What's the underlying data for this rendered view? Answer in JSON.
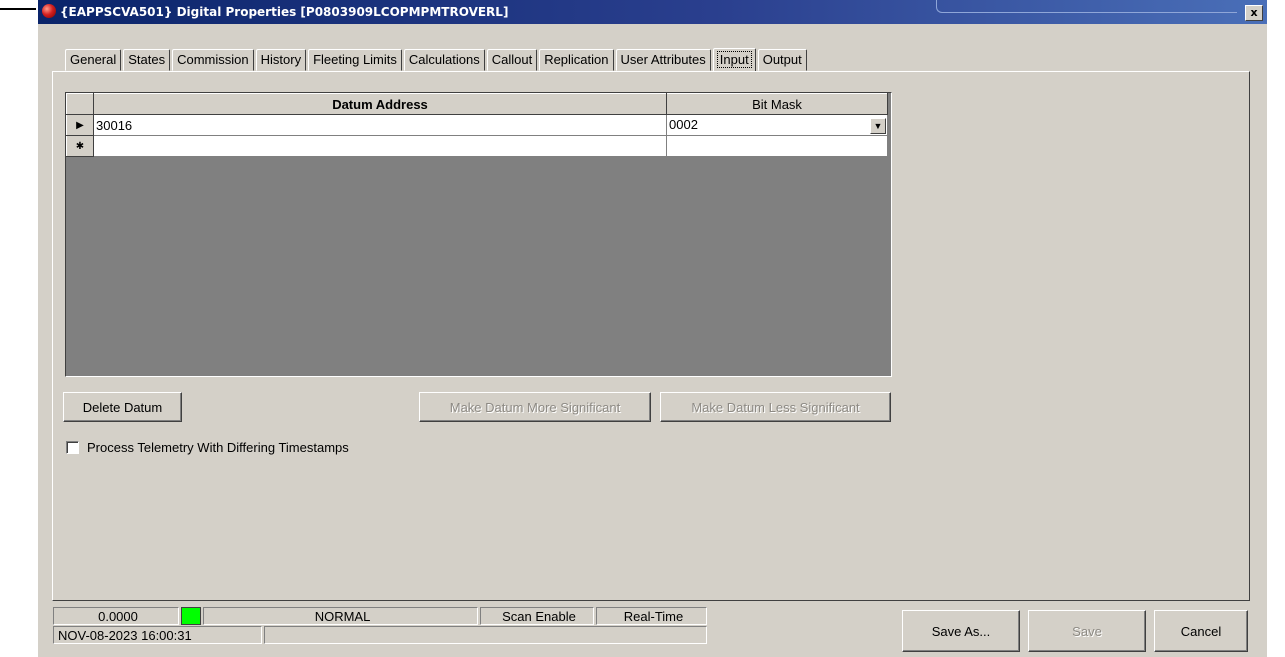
{
  "window": {
    "title": "{EAPPSCVA501} Digital Properties [P0803909LCOPMPMTROVERL]",
    "close_label": "x"
  },
  "tabs": [
    {
      "label": "General"
    },
    {
      "label": "States"
    },
    {
      "label": "Commission"
    },
    {
      "label": "History"
    },
    {
      "label": "Fleeting Limits"
    },
    {
      "label": "Calculations"
    },
    {
      "label": "Callout"
    },
    {
      "label": "Replication"
    },
    {
      "label": "User Attributes"
    },
    {
      "label": "Input",
      "active": true
    },
    {
      "label": "Output"
    }
  ],
  "grid": {
    "headers": {
      "datum_address": "Datum Address",
      "bit_mask": "Bit Mask"
    },
    "rows": [
      {
        "indicator": "▶",
        "datum_address": "30016",
        "bit_mask": "0002"
      },
      {
        "indicator": "✱",
        "datum_address": "",
        "bit_mask": ""
      }
    ]
  },
  "buttons": {
    "delete_datum": "Delete Datum",
    "more_significant": "Make Datum More Significant",
    "less_significant": "Make Datum Less Significant",
    "save_as": "Save As...",
    "save": "Save",
    "cancel": "Cancel"
  },
  "checkbox": {
    "label": "Process Telemetry With Differing Timestamps",
    "checked": false
  },
  "status": {
    "value": "0.0000",
    "state": "NORMAL",
    "scan": "Scan Enable",
    "mode": "Real-Time",
    "timestamp": "NOV-08-2023 16:00:31",
    "led_color": "#00ff00"
  }
}
